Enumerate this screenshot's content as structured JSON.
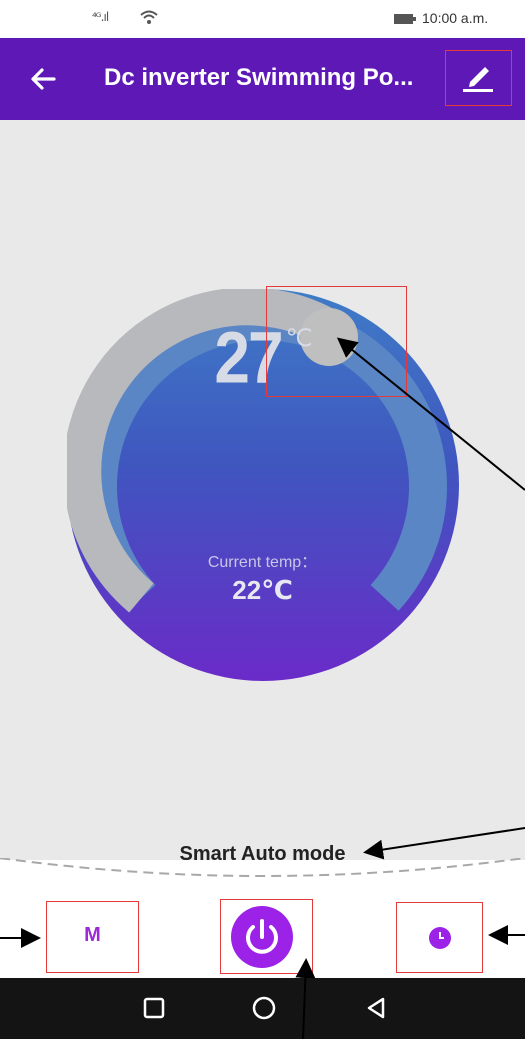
{
  "status_bar": {
    "signal_text": "⁴ᴳ.ıl",
    "time": "10:00 a.m.",
    "icons": [
      "signal-icon",
      "wifi-icon",
      "battery-icon"
    ]
  },
  "app_bar": {
    "title": "Dc inverter Swimming Po...",
    "back_icon": "arrow-left-icon",
    "edit_icon": "edit-pencil-icon",
    "background": "#5d18b6"
  },
  "thermostat": {
    "set_temperature": "27",
    "unit": "℃",
    "current_temp_label": "Current temp：",
    "current_temp_value": "22℃",
    "ring_colors": [
      "#3f7cc7",
      "#6a2bc8"
    ]
  },
  "mode": {
    "label": "Smart Auto mode"
  },
  "controls": {
    "mode_button_label": "M",
    "power_icon": "power-icon",
    "timer_icon": "clock-icon",
    "accent": "#9b22e6"
  },
  "nav_bar": {
    "icons": [
      "recent-apps-icon",
      "home-icon",
      "back-triangle-icon"
    ]
  }
}
